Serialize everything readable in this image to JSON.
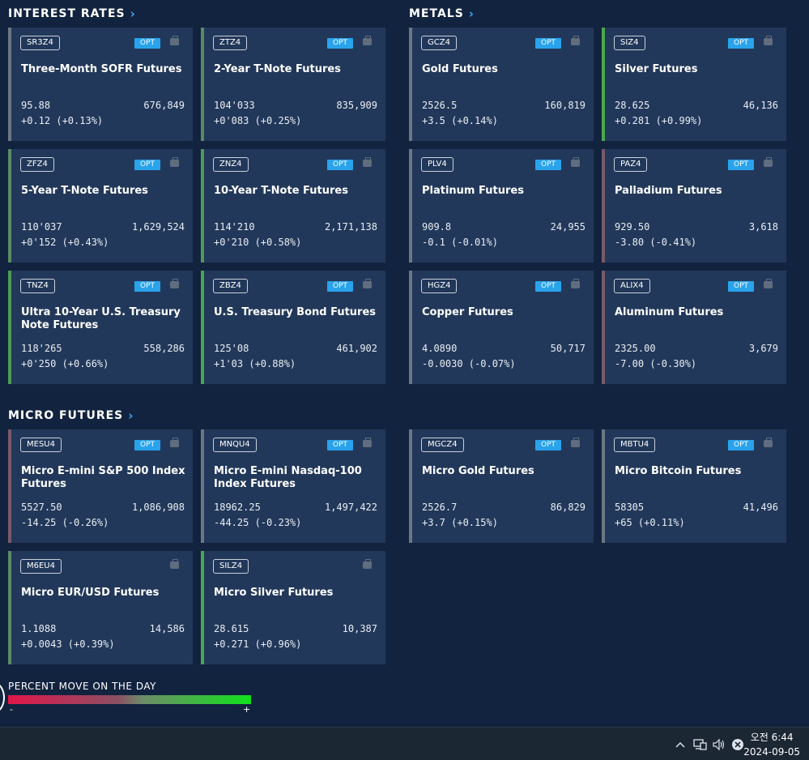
{
  "sections": {
    "interest_rates": "INTEREST RATES",
    "metals": "METALS",
    "micro_futures": "MICRO FUTURES"
  },
  "opt_label": "OPT",
  "cards": [
    {
      "ticker": "SR3Z4",
      "name": "Three-Month SOFR Futures",
      "price": "95.88",
      "volume": "676,849",
      "change": "+0.12 (+0.13%)",
      "opt": true,
      "bar_color": "#6b7785"
    },
    {
      "ticker": "ZTZ4",
      "name": "2-Year T-Note Futures",
      "price": "104'033",
      "volume": "835,909",
      "change": "+0'083 (+0.25%)",
      "opt": true,
      "bar_color": "#5c8a63"
    },
    {
      "ticker": "GCZ4",
      "name": "Gold Futures",
      "price": "2526.5",
      "volume": "160,819",
      "change": "+3.5 (+0.14%)",
      "opt": true,
      "bar_color": "#6b7785"
    },
    {
      "ticker": "SIZ4",
      "name": "Silver Futures",
      "price": "28.625",
      "volume": "46,136",
      "change": "+0.281 (+0.99%)",
      "opt": true,
      "bar_color": "#4aa84c"
    },
    {
      "ticker": "ZFZ4",
      "name": "5-Year T-Note Futures",
      "price": "110'037",
      "volume": "1,629,524",
      "change": "+0'152 (+0.43%)",
      "opt": true,
      "bar_color": "#5c8a63"
    },
    {
      "ticker": "ZNZ4",
      "name": "10-Year T-Note Futures",
      "price": "114'210",
      "volume": "2,171,138",
      "change": "+0'210 (+0.58%)",
      "opt": true,
      "bar_color": "#4f9a55"
    },
    {
      "ticker": "PLV4",
      "name": "Platinum Futures",
      "price": "909.8",
      "volume": "24,955",
      "change": "-0.1 (-0.01%)",
      "opt": true,
      "bar_color": "#6b7785"
    },
    {
      "ticker": "PAZ4",
      "name": "Palladium Futures",
      "price": "929.50",
      "volume": "3,618",
      "change": "-3.80 (-0.41%)",
      "opt": true,
      "bar_color": "#7a5a6a"
    },
    {
      "ticker": "TNZ4",
      "name": "Ultra 10-Year U.S. Treasury Note Futures",
      "price": "118'265",
      "volume": "558,286",
      "change": "+0'250 (+0.66%)",
      "opt": true,
      "bar_color": "#4f9a55"
    },
    {
      "ticker": "ZBZ4",
      "name": "U.S. Treasury Bond Futures",
      "price": "125'08",
      "volume": "461,902",
      "change": "+1'03 (+0.88%)",
      "opt": true,
      "bar_color": "#45a84b"
    },
    {
      "ticker": "HGZ4",
      "name": "Copper Futures",
      "price": "4.0890",
      "volume": "50,717",
      "change": "-0.0030 (-0.07%)",
      "opt": true,
      "bar_color": "#6b7785"
    },
    {
      "ticker": "ALIX4",
      "name": "Aluminum Futures",
      "price": "2325.00",
      "volume": "3,679",
      "change": "-7.00 (-0.30%)",
      "opt": true,
      "bar_color": "#7a5a6a"
    },
    {
      "ticker": "MESU4",
      "name": "Micro E-mini S&P 500 Index Futures",
      "price": "5527.50",
      "volume": "1,086,908",
      "change": "-14.25 (-0.26%)",
      "opt": true,
      "bar_color": "#7a5a6a"
    },
    {
      "ticker": "MNQU4",
      "name": "Micro E-mini Nasdaq-100 Index Futures",
      "price": "18962.25",
      "volume": "1,497,422",
      "change": "-44.25 (-0.23%)",
      "opt": true,
      "bar_color": "#6b7785"
    },
    {
      "ticker": "MGCZ4",
      "name": "Micro Gold Futures",
      "price": "2526.7",
      "volume": "86,829",
      "change": "+3.7 (+0.15%)",
      "opt": true,
      "bar_color": "#6b7785"
    },
    {
      "ticker": "MBTU4",
      "name": "Micro Bitcoin Futures",
      "price": "58305",
      "volume": "41,496",
      "change": "+65 (+0.11%)",
      "opt": true,
      "bar_color": "#6b7785"
    },
    {
      "ticker": "M6EU4",
      "name": "Micro EUR/USD Futures",
      "price": "1.1088",
      "volume": "14,586",
      "change": "+0.0043 (+0.39%)",
      "opt": false,
      "bar_color": "#5c8a63"
    },
    {
      "ticker": "SILZ4",
      "name": "Micro Silver Futures",
      "price": "28.615",
      "volume": "10,387",
      "change": "+0.271 (+0.96%)",
      "opt": false,
      "bar_color": "#4aa84c"
    }
  ],
  "legend": {
    "label": "PERCENT MOVE ON THE DAY",
    "min": "-",
    "max": "+"
  },
  "taskbar": {
    "time": "오전 6:44",
    "date": "2024-09-05"
  }
}
